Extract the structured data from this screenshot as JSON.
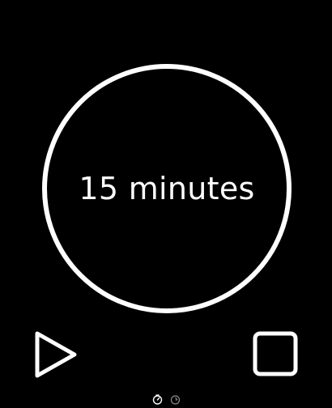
{
  "timer": {
    "duration_label": "15 minutes"
  },
  "controls": {
    "play_icon": "play-icon",
    "stop_icon": "stop-icon"
  },
  "pager": {
    "pages": [
      {
        "icon": "timer-icon",
        "active": true
      },
      {
        "icon": "stopwatch-icon",
        "active": false
      }
    ]
  },
  "colors": {
    "background": "#000000",
    "foreground": "#ffffff",
    "inactive": "#8a8a8a"
  }
}
